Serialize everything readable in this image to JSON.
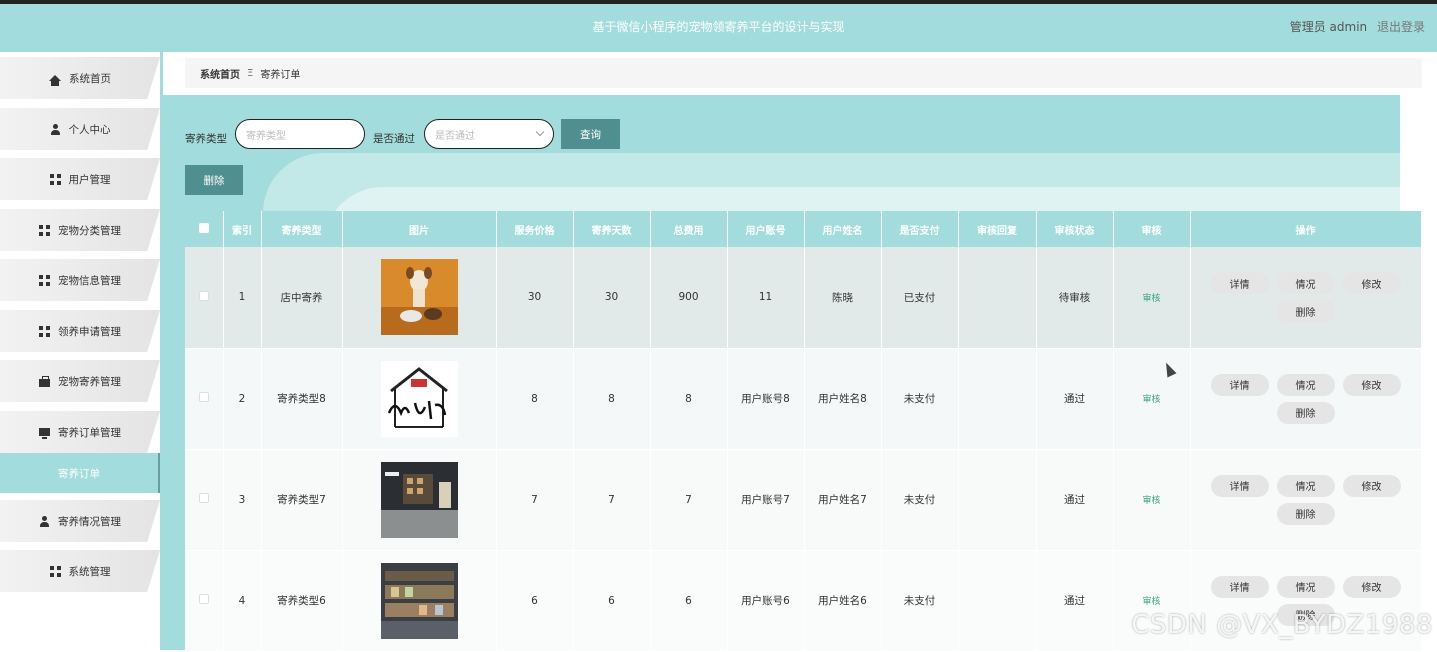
{
  "header": {
    "title": "基于微信小程序的宠物领寄养平台的设计与实现",
    "user_label": "管理员 admin",
    "logout_label": "退出登录"
  },
  "sidebar": {
    "items": [
      {
        "label": "系统首页",
        "icon": "home-icon"
      },
      {
        "label": "个人中心",
        "icon": "person-icon"
      },
      {
        "label": "用户管理",
        "icon": "grid-icon"
      },
      {
        "label": "宠物分类管理",
        "icon": "grid-icon"
      },
      {
        "label": "宠物信息管理",
        "icon": "grid-icon"
      },
      {
        "label": "领养申请管理",
        "icon": "grid-icon"
      },
      {
        "label": "宠物寄养管理",
        "icon": "briefcase-icon"
      },
      {
        "label": "寄养订单管理",
        "icon": "monitor-icon"
      },
      {
        "label": "寄养订单",
        "icon": ""
      },
      {
        "label": "寄养情况管理",
        "icon": "person-icon"
      },
      {
        "label": "系统管理",
        "icon": "grid-icon"
      }
    ]
  },
  "breadcrumb": {
    "home": "系统首页",
    "sep": "Ξ",
    "current": "寄养订单"
  },
  "search": {
    "type_label": "寄养类型",
    "type_placeholder": "寄养类型",
    "pass_label": "是否通过",
    "pass_placeholder": "是否通过",
    "query_label": "查询"
  },
  "toolbar": {
    "delete_label": "删除"
  },
  "table": {
    "headers": [
      "",
      "索引",
      "寄养类型",
      "图片",
      "服务价格",
      "寄养天数",
      "总费用",
      "用户账号",
      "用户姓名",
      "是否支付",
      "审核回复",
      "审核状态",
      "审核",
      "操作"
    ],
    "rows": [
      {
        "index": "1",
        "type": "店中寄养",
        "image": "dog-photo",
        "price": "30",
        "days": "30",
        "total": "900",
        "account": "11",
        "name": "陈晓",
        "paid": "已支付",
        "reply": "",
        "status": "待审核",
        "audit": "审核"
      },
      {
        "index": "2",
        "type": "寄养类型8",
        "image": "pet-shop-logo",
        "price": "8",
        "days": "8",
        "total": "8",
        "account": "用户账号8",
        "name": "用户姓名8",
        "paid": "未支付",
        "reply": "",
        "status": "通过",
        "audit": "审核"
      },
      {
        "index": "3",
        "type": "寄养类型7",
        "image": "shop-interior-photo",
        "price": "7",
        "days": "7",
        "total": "7",
        "account": "用户账号7",
        "name": "用户姓名7",
        "paid": "未支付",
        "reply": "",
        "status": "通过",
        "audit": "审核"
      },
      {
        "index": "4",
        "type": "寄养类型6",
        "image": "pet-store-photo",
        "price": "6",
        "days": "6",
        "total": "6",
        "account": "用户账号6",
        "name": "用户姓名6",
        "paid": "未支付",
        "reply": "",
        "status": "通过",
        "audit": "审核"
      }
    ],
    "op_labels": {
      "detail": "详情",
      "situation": "情况",
      "edit": "修改",
      "delete": "删除"
    }
  },
  "watermark": "CSDN @VX_BYDZ1988",
  "colors": {
    "accent": "#a3dcdc",
    "button": "#4f8f8f",
    "audit_link": "#3aa57a"
  }
}
